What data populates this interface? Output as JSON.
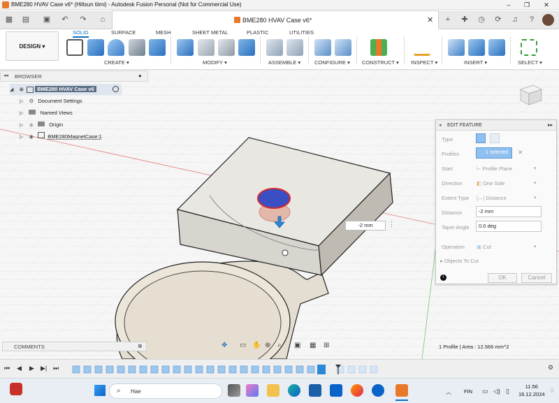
{
  "window": {
    "title": "BME280 HVAV Case v6* (Hiltsun tiimi) - Autodesk Fusion Personal (Not for Commercial Use)",
    "controls": {
      "minimize": "–",
      "maximize": "❐",
      "close": "✕"
    }
  },
  "doc_tab": {
    "label": "BME280 HVAV Case v6*",
    "close": "✕"
  },
  "ribbon": {
    "workspace": "DESIGN ▾",
    "tabs": [
      "SOLID",
      "SURFACE",
      "MESH",
      "SHEET METAL",
      "PLASTIC",
      "UTILITIES"
    ],
    "active_tab": "SOLID",
    "groups": [
      "CREATE ▾",
      "MODIFY ▾",
      "ASSEMBLE ▾",
      "CONFIGURE ▾",
      "CONSTRUCT ▾",
      "INSPECT ▾",
      "INSERT ▾",
      "SELECT ▾"
    ]
  },
  "browser": {
    "title": "BROWSER",
    "root": "BME280 HVAV Case v6",
    "items": [
      "Document Settings",
      "Named Views",
      "Origin",
      "BME280MagnetCase:1"
    ]
  },
  "comments": {
    "title": "COMMENTS"
  },
  "status": {
    "text": "1 Profile | Area : 12.566 mm^2"
  },
  "dimension_input": {
    "value": "-2 mm"
  },
  "edit_feature": {
    "title": "EDIT FEATURE",
    "fields": {
      "type_label": "Type",
      "profiles_label": "Profiles",
      "profiles_value": "1 selected",
      "start_label": "Start",
      "start_value": "Profile Plane",
      "direction_label": "Direction",
      "direction_value": "One Side",
      "extent_label": "Extent Type",
      "extent_value": "Distance",
      "distance_label": "Distance",
      "distance_value": "-2 mm",
      "taper_label": "Taper Angle",
      "taper_value": "0.0 deg",
      "operation_label": "Operation",
      "operation_value": "Cut",
      "objects_label": "Objects To Cut"
    },
    "ok": "OK",
    "cancel": "Cancel"
  },
  "taskbar": {
    "search_placeholder": "Hae",
    "lang": "FIN",
    "time": "11.56",
    "date": "16.12.2024"
  },
  "colors": {
    "accent": "#0a6fc2",
    "fusion_orange": "#e8792a",
    "profile_red": "#d42a2a",
    "profile_blue": "#3a4fc4"
  }
}
